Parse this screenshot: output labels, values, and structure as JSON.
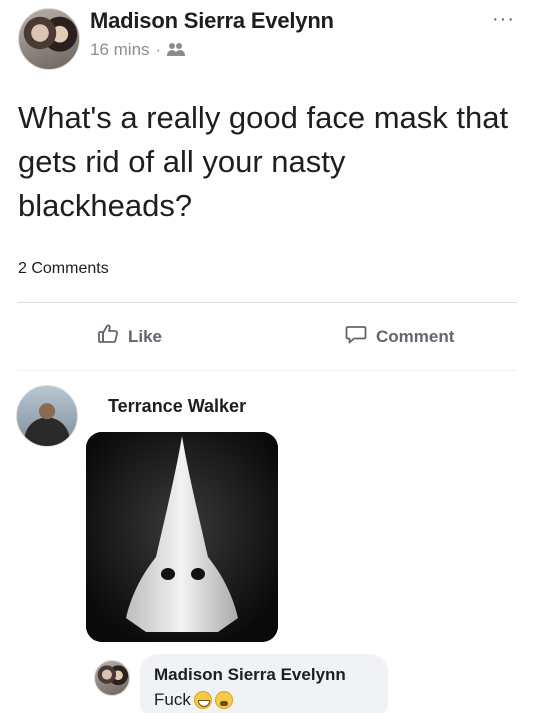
{
  "post": {
    "author": "Madison Sierra Evelynn",
    "time": "16 mins",
    "separator": "·",
    "audience_icon": "friends-icon",
    "more_label": "···",
    "text": "What's a really good face mask that gets rid of all your nasty blackheads?",
    "comment_count": "2 Comments"
  },
  "actions": {
    "like_label": "Like",
    "like_icon": "thumbs-up-icon",
    "comment_label": "Comment",
    "comment_icon": "speech-bubble-icon"
  },
  "comments": [
    {
      "author": "Terrance Walker",
      "attachment": "photo"
    },
    {
      "author": "Madison Sierra Evelynn",
      "text": "Fuck",
      "emojis": [
        "laughing-face-emoji",
        "crying-face-emoji"
      ]
    }
  ],
  "colors": {
    "text_primary": "#1c1e21",
    "text_secondary": "#606770",
    "meta_gray": "#8a8d91",
    "bubble_bg": "#f0f2f5",
    "divider": "#dadde1"
  }
}
